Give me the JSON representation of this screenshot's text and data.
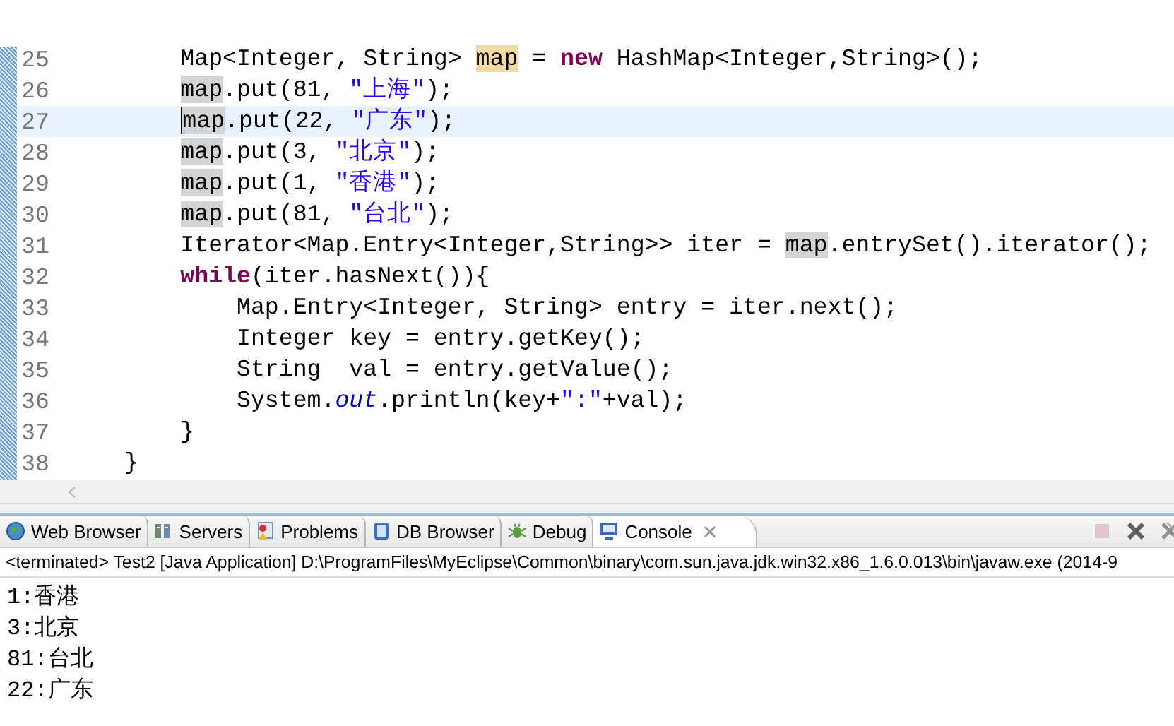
{
  "editor": {
    "lines": [
      {
        "number": "25",
        "current": false,
        "tokens": [
          {
            "kind": "text",
            "text": "        Map<Integer, String> "
          },
          {
            "kind": "declaration",
            "text": "map"
          },
          {
            "kind": "text",
            "text": " = "
          },
          {
            "kind": "keyword",
            "text": "new"
          },
          {
            "kind": "text",
            "text": " HashMap<Integer,String>();"
          }
        ]
      },
      {
        "number": "26",
        "current": false,
        "tokens": [
          {
            "kind": "occurrence",
            "text": "        map"
          },
          {
            "kind": "text",
            "text": ".put(81, "
          },
          {
            "kind": "string",
            "text": "\"上海\""
          },
          {
            "kind": "text",
            "text": ");"
          }
        ]
      },
      {
        "number": "27",
        "current": true,
        "tokens": [
          {
            "kind": "occurrence",
            "text": "        map"
          },
          {
            "kind": "text",
            "text": ".put(22, "
          },
          {
            "kind": "string",
            "text": "\"广东\""
          },
          {
            "kind": "text",
            "text": ");"
          }
        ]
      },
      {
        "number": "28",
        "current": false,
        "tokens": [
          {
            "kind": "occurrence",
            "text": "        map"
          },
          {
            "kind": "text",
            "text": ".put(3, "
          },
          {
            "kind": "string",
            "text": "\"北京\""
          },
          {
            "kind": "text",
            "text": ");"
          }
        ]
      },
      {
        "number": "29",
        "current": false,
        "tokens": [
          {
            "kind": "occurrence",
            "text": "        map"
          },
          {
            "kind": "text",
            "text": ".put(1, "
          },
          {
            "kind": "string",
            "text": "\"香港\""
          },
          {
            "kind": "text",
            "text": ");"
          }
        ]
      },
      {
        "number": "30",
        "current": false,
        "tokens": [
          {
            "kind": "occurrence",
            "text": "        map"
          },
          {
            "kind": "text",
            "text": ".put(81, "
          },
          {
            "kind": "string",
            "text": "\"台北\""
          },
          {
            "kind": "text",
            "text": ");"
          }
        ]
      },
      {
        "number": "31",
        "current": false,
        "tokens": [
          {
            "kind": "text",
            "text": "        Iterator<Map.Entry<Integer,String>> iter = "
          },
          {
            "kind": "occurrence",
            "text": "map"
          },
          {
            "kind": "text",
            "text": ".entrySet().iterator();"
          }
        ]
      },
      {
        "number": "32",
        "current": false,
        "tokens": [
          {
            "kind": "keyword",
            "text": "        while"
          },
          {
            "kind": "text",
            "text": "(iter.hasNext()){"
          }
        ]
      },
      {
        "number": "33",
        "current": false,
        "tokens": [
          {
            "kind": "text",
            "text": "            Map.Entry<Integer, String> entry = iter.next();"
          }
        ]
      },
      {
        "number": "34",
        "current": false,
        "tokens": [
          {
            "kind": "text",
            "text": "            Integer key = entry.getKey();"
          }
        ]
      },
      {
        "number": "35",
        "current": false,
        "tokens": [
          {
            "kind": "text",
            "text": "            String  val = entry.getValue();"
          }
        ]
      },
      {
        "number": "36",
        "current": false,
        "tokens": [
          {
            "kind": "text",
            "text": "            System."
          },
          {
            "kind": "static",
            "text": "out"
          },
          {
            "kind": "text",
            "text": ".println(key+"
          },
          {
            "kind": "string",
            "text": "\":\""
          },
          {
            "kind": "text",
            "text": "+val);"
          }
        ]
      },
      {
        "number": "37",
        "current": false,
        "tokens": [
          {
            "kind": "text",
            "text": "        }"
          }
        ]
      },
      {
        "number": "38",
        "current": false,
        "tokens": [
          {
            "kind": "text",
            "text": "    }"
          }
        ]
      }
    ]
  },
  "console": {
    "tabs": [
      {
        "label": "Web Browser",
        "selected": false
      },
      {
        "label": "Servers",
        "selected": false
      },
      {
        "label": "Problems",
        "selected": false
      },
      {
        "label": "DB Browser",
        "selected": false
      },
      {
        "label": "Debug",
        "selected": false
      },
      {
        "label": "Console",
        "selected": true
      }
    ],
    "toolbar_buttons": [
      {
        "kind": "stop",
        "disabled": true
      },
      {
        "kind": "remove",
        "disabled": false
      },
      {
        "kind": "remove-all",
        "disabled": false
      }
    ],
    "header": "<terminated> Test2 [Java Application] D:\\ProgramFiles\\MyEclipse\\Common\\binary\\com.sun.java.jdk.win32.x86_1.6.0.013\\bin\\javaw.exe (2014-9",
    "output": [
      "1:香港",
      "3:北京",
      "81:台北",
      "22:广东"
    ]
  }
}
